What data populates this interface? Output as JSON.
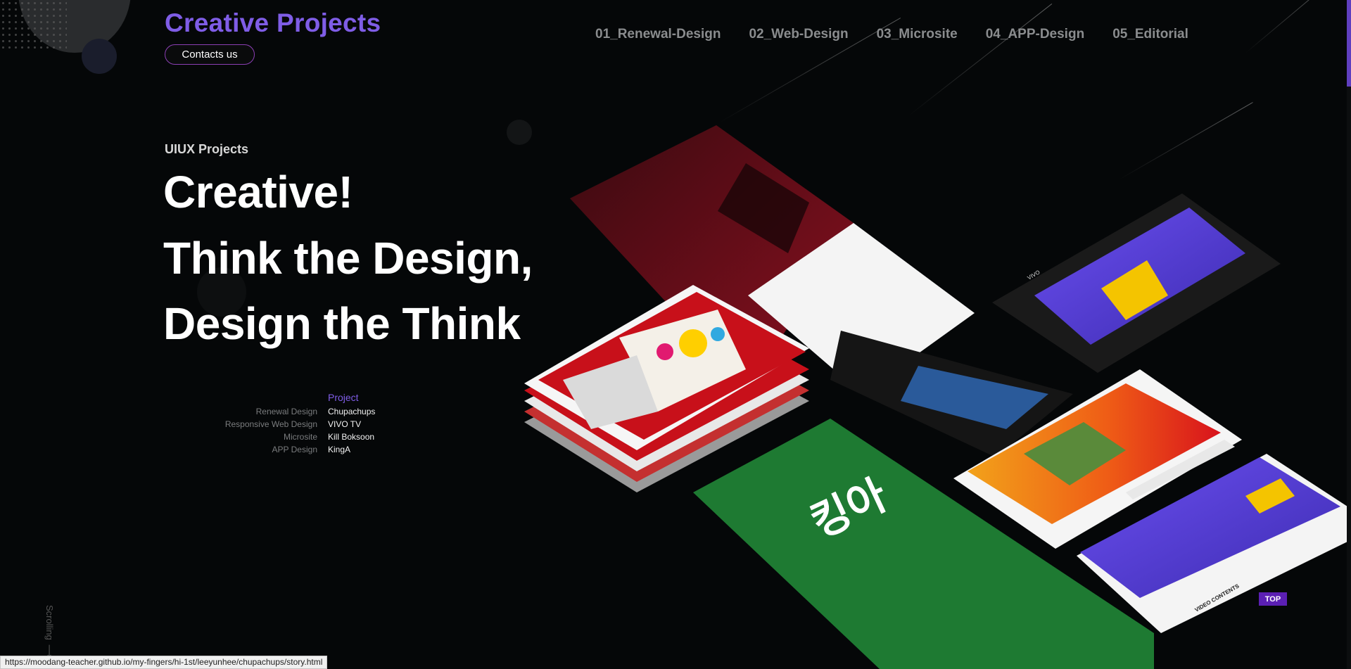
{
  "header": {
    "brand": "Creative Projects",
    "contact_label": "Contacts us",
    "nav": [
      "01_Renewal-Design",
      "02_Web-Design",
      "03_Microsite",
      "04_APP-Design",
      "05_Editorial"
    ]
  },
  "hero": {
    "eyebrow": "UIUX Projects",
    "lines": [
      "Creative!",
      "Think the Design,",
      "Design the Think"
    ]
  },
  "projects": {
    "heading": "Project",
    "items": [
      {
        "category": "Renewal Design",
        "name": "Chupachups"
      },
      {
        "category": "Responsive Web Design",
        "name": "VIVO TV"
      },
      {
        "category": "Microsite",
        "name": "Kill Boksoon"
      },
      {
        "category": "APP Design",
        "name": "KingA"
      }
    ]
  },
  "mockups": {
    "kinga_logo": "킹아",
    "vivo_brand": "VIVO",
    "video_contents": "VIDEO CONTENTS"
  },
  "scroll_label": "Scrolling",
  "top_button": "TOP",
  "status_url": "https://moodang-teacher.github.io/my-fingers/hi-1st/leeyunhee/chupachups/story.html",
  "colors": {
    "accent": "#7f5de6",
    "background": "#050708",
    "kinga_green": "#1e7a32",
    "chupa_red": "#c8101a",
    "vivo_purple": "#5a3fd6"
  }
}
